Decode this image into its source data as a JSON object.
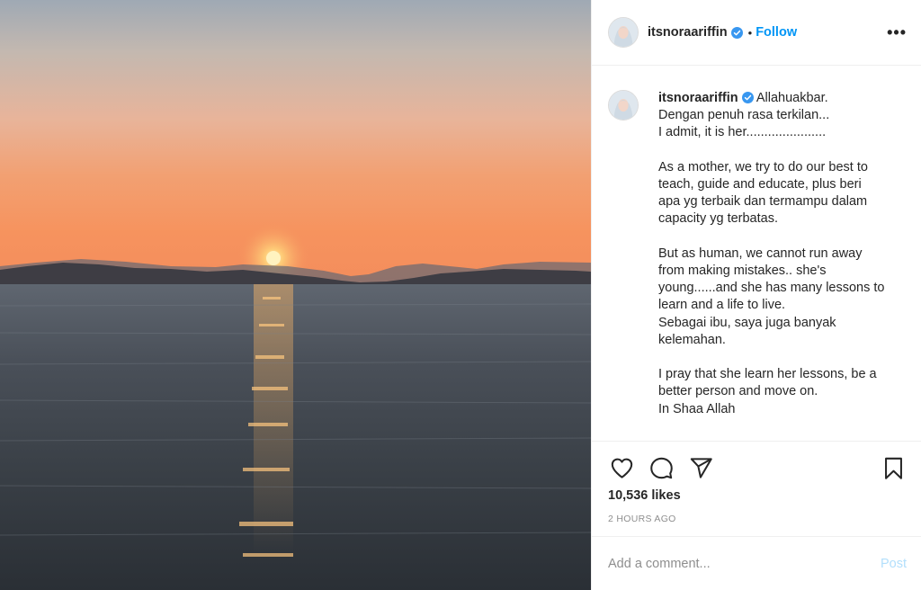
{
  "post": {
    "username": "itsnoraariffin",
    "follow_label": "Follow",
    "separator": "•",
    "more_label": "•••",
    "verified_color": "#3897f0",
    "caption": {
      "first_line": "Allahuakbar.",
      "lines": [
        "Dengan penuh rasa terkilan...",
        "I admit, it is her......................",
        "",
        "As a mother, we try to do our best to",
        "teach, guide and educate, plus beri",
        "apa yg terbaik dan termampu dalam",
        "capacity yg terbatas.",
        "",
        "But as human, we cannot run away",
        "from making mistakes.. she's",
        "young......and she has many lessons to",
        "learn and a life to live.",
        "Sebagai ibu, saya juga banyak",
        "kelemahan.",
        "",
        "I pray that she learn her lessons, be a",
        "better person and move on.",
        "In Shaa Allah"
      ]
    },
    "likes": "10,536 likes",
    "timestamp": "2 HOURS AGO"
  },
  "actions": {
    "icons": [
      "heart-icon",
      "comment-icon",
      "share-icon",
      "bookmark-icon"
    ]
  },
  "comment": {
    "placeholder": "Add a comment...",
    "post_label": "Post"
  },
  "colors": {
    "link": "#0095f6",
    "post_disabled": "#b2dffc",
    "muted": "#8e8e8e"
  }
}
